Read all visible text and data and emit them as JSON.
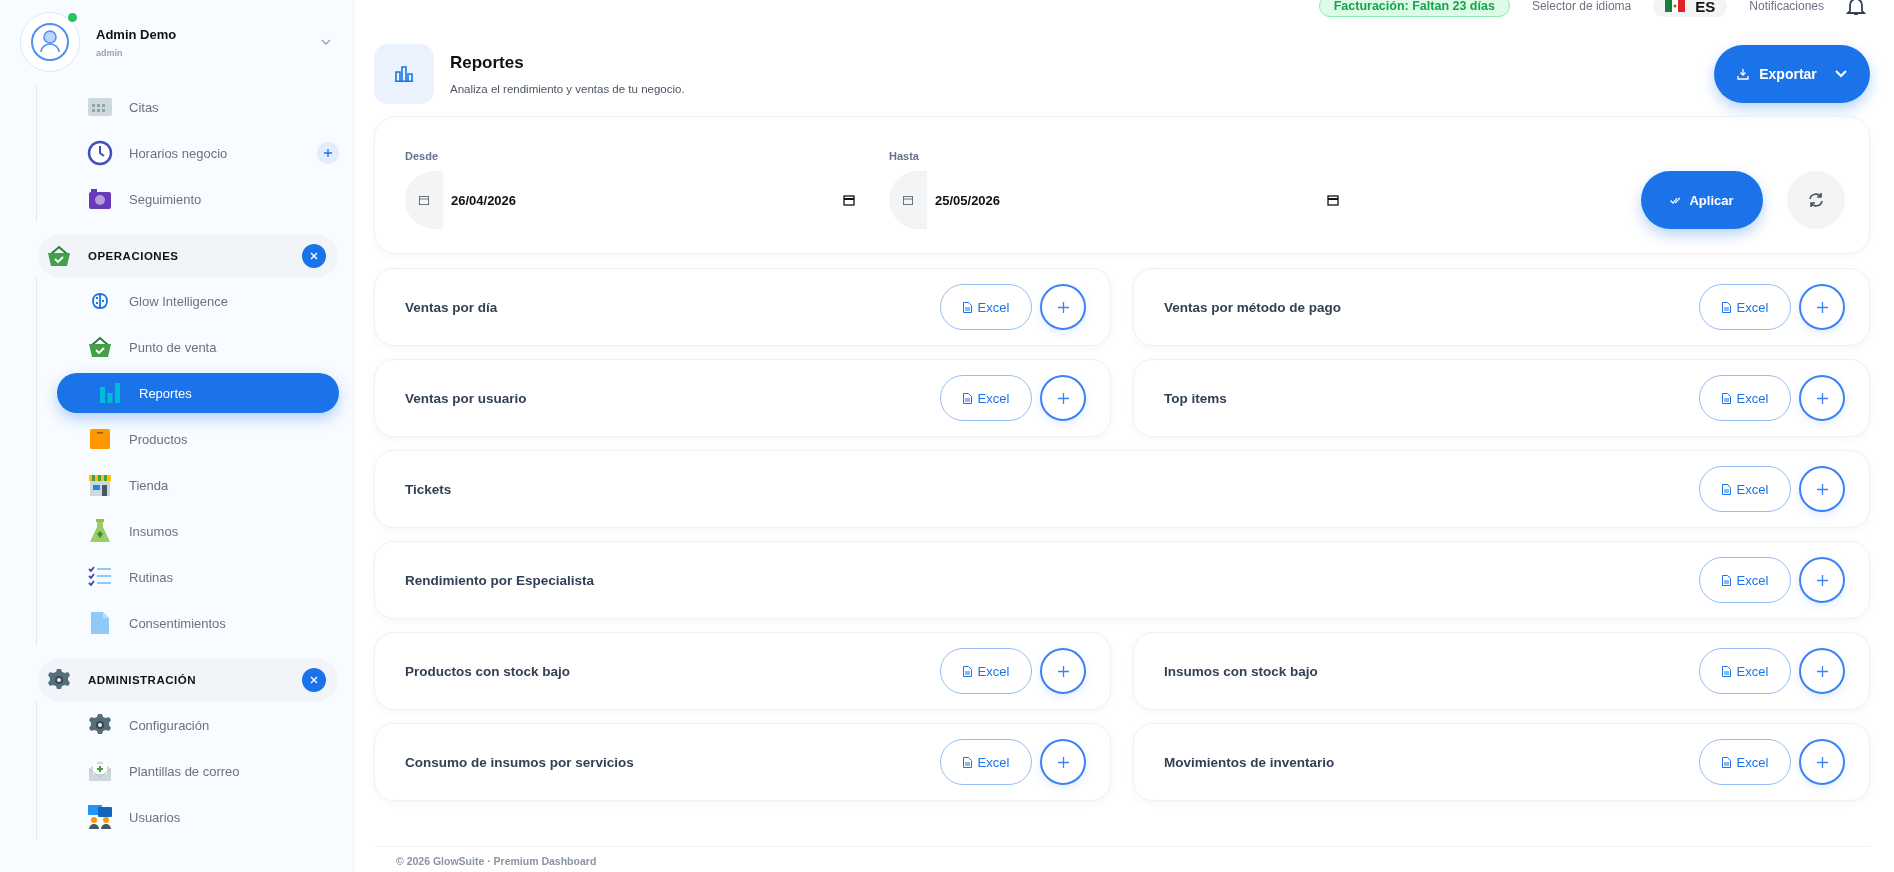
{
  "topbar": {
    "billing_badge": "Facturación: Faltan 23 días",
    "language_label": "Selector de idioma",
    "language": "ES",
    "notifications_label": "Notificaciones"
  },
  "sidebar": {
    "user": {
      "name": "Admin Demo",
      "role": "admin",
      "online": true
    },
    "sections": [
      {
        "items": [
          {
            "label": "Citas",
            "selected": false,
            "add": false
          },
          {
            "label": "Horarios negocio",
            "selected": false,
            "add": true
          },
          {
            "label": "Seguimiento",
            "selected": false,
            "add": false
          }
        ]
      },
      {
        "title": "OPERACIONES",
        "expanded": true,
        "items": [
          {
            "label": "Glow Intelligence",
            "selected": false,
            "add": false
          },
          {
            "label": "Punto de venta",
            "selected": false,
            "add": false
          },
          {
            "label": "Reportes",
            "selected": true,
            "add": false
          },
          {
            "label": "Productos",
            "selected": false,
            "add": false
          },
          {
            "label": "Tienda",
            "selected": false,
            "add": false
          },
          {
            "label": "Insumos",
            "selected": false,
            "add": false
          },
          {
            "label": "Rutinas",
            "selected": false,
            "add": false
          },
          {
            "label": "Consentimientos",
            "selected": false,
            "add": false
          }
        ]
      },
      {
        "title": "ADMINISTRACIÓN",
        "expanded": true,
        "items": [
          {
            "label": "Configuración",
            "selected": false,
            "add": false
          },
          {
            "label": "Plantillas de correo",
            "selected": false,
            "add": false
          },
          {
            "label": "Usuarios",
            "selected": false,
            "add": false
          }
        ]
      }
    ]
  },
  "header": {
    "title": "Reportes",
    "subtitle": "Analiza el rendimiento y ventas de tu negocio.",
    "export_button": "Exportar"
  },
  "filters": {
    "fields": [
      {
        "label": "Desde",
        "value": "26/04/2026"
      },
      {
        "label": "Hasta",
        "value": "25/05/2026"
      }
    ],
    "apply_button": "Aplicar"
  },
  "reports": [
    {
      "title": "Ventas por día",
      "kind": "half",
      "excel": "Excel"
    },
    {
      "title": "Ventas por método de pago",
      "kind": "half",
      "excel": "Excel"
    },
    {
      "title": "Ventas por usuario",
      "kind": "half",
      "excel": "Excel"
    },
    {
      "title": "Top items",
      "kind": "half",
      "excel": "Excel"
    },
    {
      "title": "Tickets",
      "kind": "wide",
      "excel": "Excel"
    },
    {
      "title": "Rendimiento por Especialista",
      "kind": "wide",
      "excel": "Excel"
    },
    {
      "title": "Productos con stock bajo",
      "kind": "half",
      "excel": "Excel"
    },
    {
      "title": "Insumos con stock bajo",
      "kind": "half",
      "excel": "Excel"
    },
    {
      "title": "Consumo de insumos por servicios",
      "kind": "half",
      "excel": "Excel"
    },
    {
      "title": "Movimientos de inventario",
      "kind": "half",
      "excel": "Excel"
    }
  ],
  "footer": "© 2026 GlowSuite · Premium Dashboard"
}
